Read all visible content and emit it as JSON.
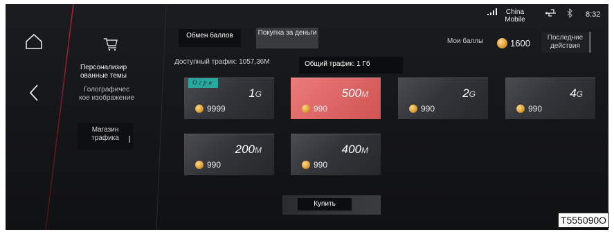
{
  "nav": {
    "home_icon": "home-icon",
    "back_icon": "back-chevron-icon",
    "cart_icon": "cart-icon"
  },
  "menu": {
    "themes": "Персонализир ованные темы",
    "holo": "Голографичес кое изображение",
    "shop": "Магазин трафика"
  },
  "tabs": {
    "exchange": "Обмен баллов",
    "buy": "Покупка за деньги"
  },
  "traffic": {
    "available": "Доступный трафик: 1057,36М",
    "total": "Общий трафик: 1 Гб"
  },
  "status": {
    "carrier": "China Mobile",
    "time": "8:32",
    "signal_icon": "signal-icon",
    "usb_icon": "usb-icon",
    "bluetooth_icon": "bluetooth-icon"
  },
  "points": {
    "label": "Мои баллы",
    "value": "1600",
    "recent": "Последние действия"
  },
  "cards": [
    {
      "size": "1",
      "unit": "G",
      "price": "9999",
      "tag": "Огра",
      "active": false
    },
    {
      "size": "500",
      "unit": "M",
      "price": "990",
      "tag": "",
      "active": true
    },
    {
      "size": "2",
      "unit": "G",
      "price": "990",
      "tag": "",
      "active": false
    },
    {
      "size": "4",
      "unit": "G",
      "price": "990",
      "tag": "",
      "active": false
    },
    {
      "size": "200",
      "unit": "M",
      "price": "990",
      "tag": "",
      "active": false
    },
    {
      "size": "400",
      "unit": "M",
      "price": "990",
      "tag": "",
      "active": false
    }
  ],
  "buy_button": "Купить",
  "figure_id": "T555090O",
  "colors": {
    "accent": "#db6262",
    "tag": "#2aa89f",
    "background": "#141518"
  }
}
